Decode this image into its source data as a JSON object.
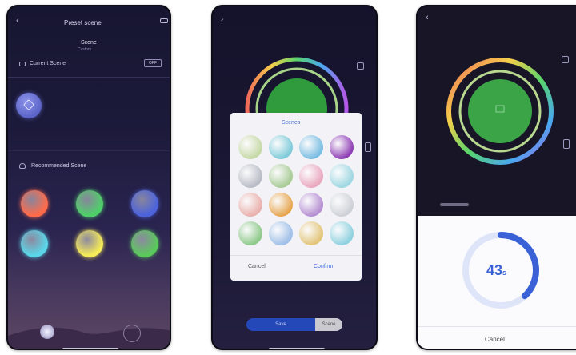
{
  "screen1": {
    "back": "‹",
    "title": "Preset scene",
    "tab_main": "Scene",
    "tab_sub": "Custom",
    "current_label": "Current Scene",
    "current_value": "OFF",
    "recommended_label": "Recommended Scene",
    "current_scene_color": "#5b63c8",
    "scene_colors": [
      "#ff6b4a",
      "#4fcf69",
      "#4c63dc",
      "#59d6e8",
      "#f5ea57",
      "#59c95a"
    ]
  },
  "screen2": {
    "back": "‹",
    "dialog_title": "Scenes",
    "cancel": "Cancel",
    "confirm": "Confirm",
    "bottom_left": "Save",
    "bottom_right": "Scene",
    "swatch_colors": [
      "#c6d9a7",
      "#7fcbd9",
      "#79bde2",
      "#8f3fb5",
      "#b9bcc6",
      "#a9cc97",
      "#eaa8bf",
      "#9fd7e2",
      "#e9b1ad",
      "#e6a650",
      "#b68fd2",
      "#cdd1d7",
      "#8ec98a",
      "#9fbfe7",
      "#e3c57a",
      "#8fd1df"
    ]
  },
  "screen3": {
    "back": "‹",
    "timer_value": "43",
    "timer_unit": "s",
    "cancel": "Cancel",
    "progress": 0.38
  }
}
